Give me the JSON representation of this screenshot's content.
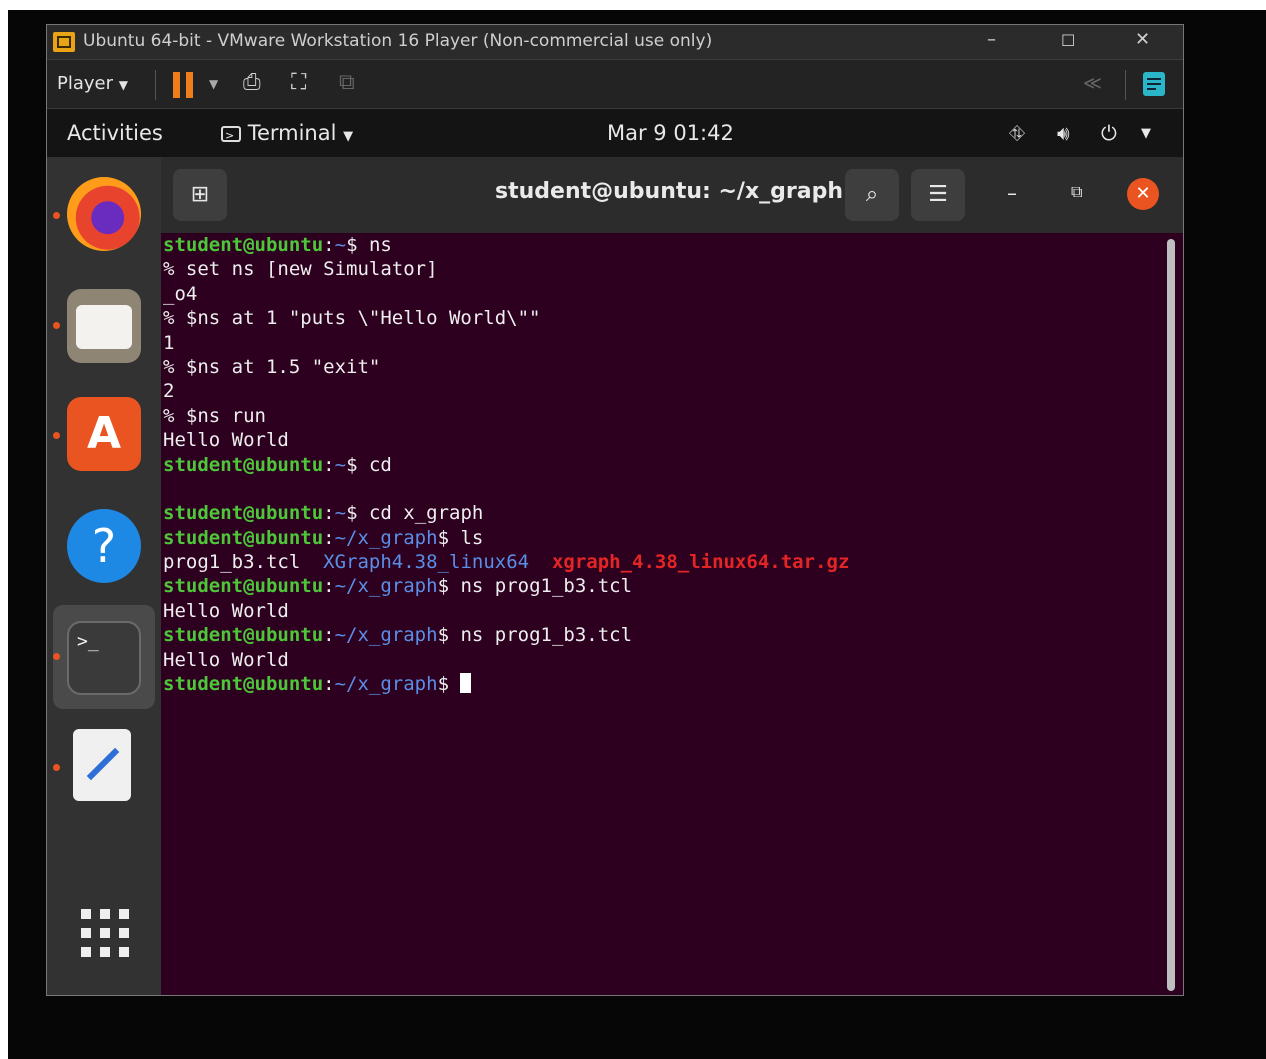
{
  "window": {
    "title": "Ubuntu 64-bit - VMware Workstation 16 Player (Non-commercial use only)",
    "minimize": "–",
    "maximize": "☐",
    "close": "✕"
  },
  "toolbar": {
    "player_label": "Player",
    "collapse_icon": "≪"
  },
  "topbar": {
    "activities": "Activities",
    "app_menu": "Terminal",
    "clock": "Mar 9  01:42"
  },
  "terminal": {
    "title": "student@ubuntu: ~/x_graph",
    "prompt_user": "student@ubuntu",
    "lines": {
      "l1_path": "~",
      "l1_cmd": "$ ns",
      "l2": "% set ns [new Simulator]",
      "l3": "_o4",
      "l4": "% $ns at 1 \"puts \\\"Hello World\\\"\"",
      "l5": "1",
      "l6": "% $ns at 1.5 \"exit\"",
      "l7": "2",
      "l8": "% $ns run",
      "l9": "Hello World",
      "l10_path": "~",
      "l10_cmd": "$ cd",
      "l12_path": "~",
      "l12_cmd": "$ cd x_graph",
      "l13_path": "~/x_graph",
      "l13_cmd": "$ ls",
      "l14_file1": "prog1_b3.tcl",
      "l14_file2": "XGraph4.38_linux64",
      "l14_file3": "xgraph_4.38_linux64.tar.gz",
      "l15_path": "~/x_graph",
      "l15_cmd": "$ ns prog1_b3.tcl",
      "l16": "Hello World",
      "l17_path": "~/x_graph",
      "l17_cmd": "$ ns prog1_b3.tcl",
      "l18": "Hello World",
      "l19_path": "~/x_graph",
      "l19_cmd": "$ "
    }
  },
  "dock": {
    "help_glyph": "?"
  },
  "colors": {
    "terminal_bg": "#2c001e",
    "prompt_green": "#4ec63a",
    "path_blue": "#5b8ee6",
    "archive_red": "#e32525",
    "accent_orange": "#e95420"
  }
}
